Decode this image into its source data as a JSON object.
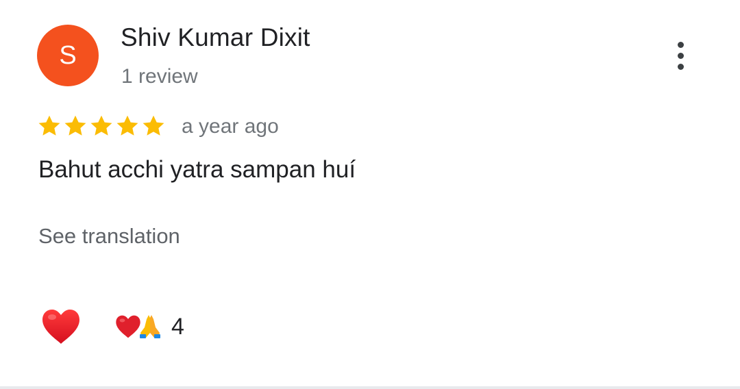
{
  "reviewer": {
    "avatar_letter": "S",
    "avatar_color": "#f4511e",
    "name": "Shiv Kumar Dixit",
    "review_count": "1 review"
  },
  "rating": {
    "stars": 5,
    "max_stars": 5,
    "star_color": "#fbbc04"
  },
  "review": {
    "time": "a year ago",
    "text": "Bahut acchi yatra sampan huí",
    "translate_label": "See translation"
  },
  "reactions": {
    "like_icon": "red-heart-icon",
    "summary_icons": [
      "red-heart-icon",
      "folded-hands-icon"
    ],
    "count": "4"
  },
  "menu": {
    "icon": "more-vert-icon"
  }
}
